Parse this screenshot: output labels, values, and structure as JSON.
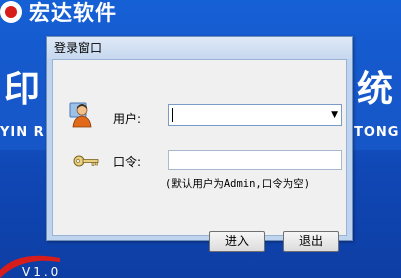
{
  "background": {
    "brand_name": "宏达软件",
    "title_left": "印",
    "title_right": "统",
    "subtitle_left": "YIN R",
    "subtitle_right": "TONG",
    "version": "V1.0",
    "colors": {
      "background": "#1452c4",
      "brand_red": "#d71c1c"
    }
  },
  "dialog": {
    "title": "登录窗口",
    "user_label": "用户:",
    "user_value": "",
    "password_label": "口令:",
    "password_value": "",
    "hint": "(默认用户为Admin,口令为空)",
    "login_button": "进入",
    "exit_button": "退出",
    "icons": {
      "user": "user-icon",
      "key": "key-icon",
      "dropdown": "chevron-down-icon"
    }
  }
}
